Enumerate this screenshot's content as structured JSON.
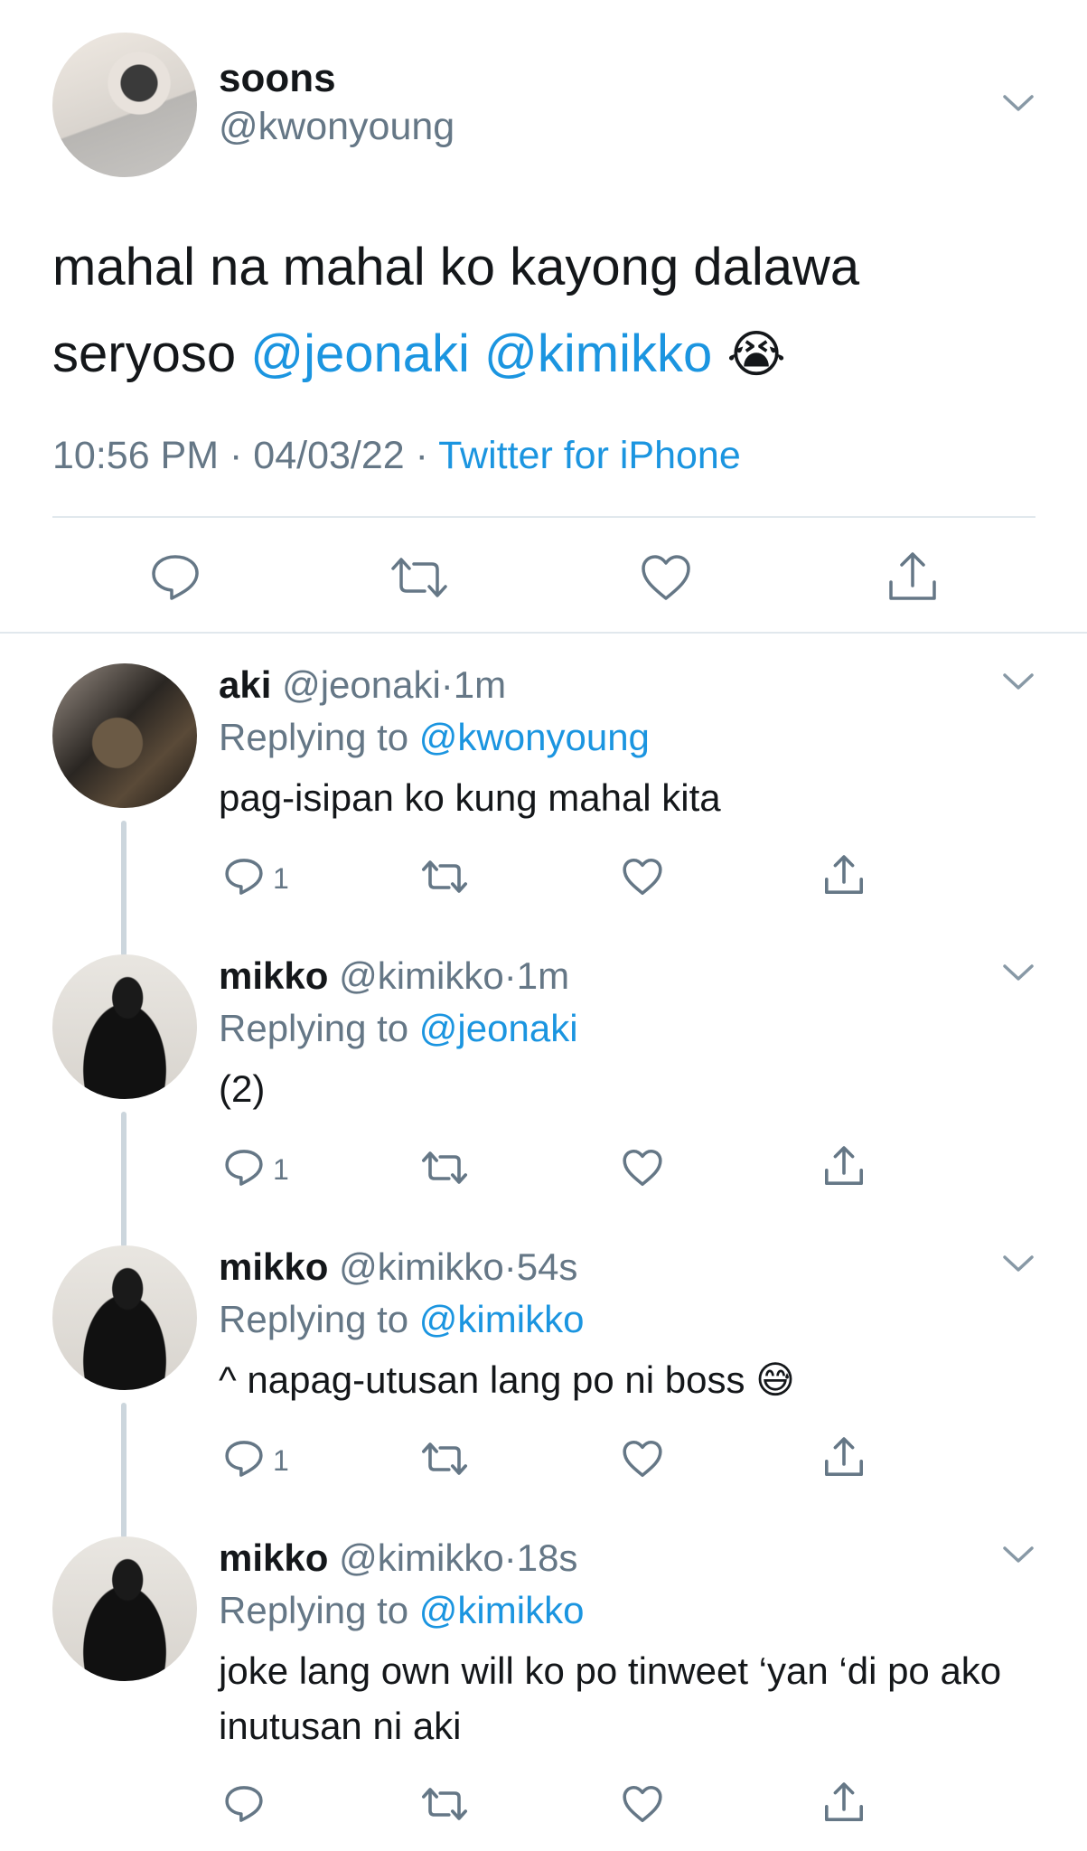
{
  "main_tweet": {
    "name": "soons",
    "handle": "@kwonyoung",
    "text_line1": "mahal na mahal ko kayong dalawa",
    "text_line2_prefix": "seryoso",
    "mention1": "@jeonaki",
    "mention2": "@kimikko",
    "emoji": "😭",
    "time": "10:56 PM",
    "date": "04/03/22",
    "source": "Twitter for iPhone",
    "sep": "·"
  },
  "replies": [
    {
      "name": "aki",
      "handle": "@jeonaki",
      "age": "1m",
      "replying_label": "Replying to",
      "replying_to": "@kwonyoung",
      "text": "pag-isipan ko kung mahal kita",
      "reply_count": "1"
    },
    {
      "name": "mikko",
      "handle": "@kimikko",
      "age": "1m",
      "replying_label": "Replying to",
      "replying_to": "@jeonaki",
      "text": "(2)",
      "reply_count": "1"
    },
    {
      "name": "mikko",
      "handle": "@kimikko",
      "age": "54s",
      "replying_label": "Replying to",
      "replying_to": "@kimikko",
      "text": "^ napag-utusan lang po ni boss 😅",
      "reply_count": "1"
    },
    {
      "name": "mikko",
      "handle": "@kimikko",
      "age": "18s",
      "replying_label": "Replying to",
      "replying_to": "@kimikko",
      "text": "joke lang own will ko po tinweet ‘yan ‘di po ako inutusan ni aki",
      "reply_count": ""
    }
  ],
  "icons": [
    "chevron-down-icon",
    "reply-icon",
    "retweet-icon",
    "like-icon",
    "share-icon"
  ],
  "colors": {
    "link": "#1b95e0",
    "meta": "#657786",
    "text": "#14171a",
    "divider": "#e1e8ed",
    "thread": "#ccd6dd"
  }
}
